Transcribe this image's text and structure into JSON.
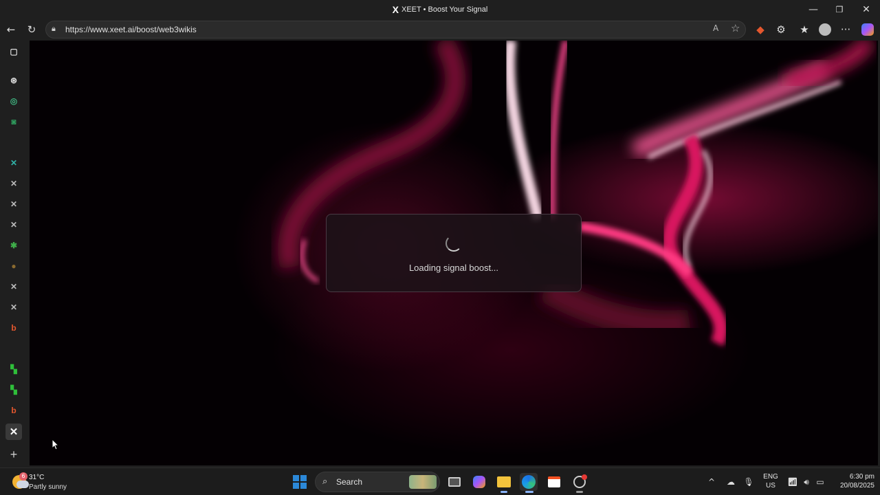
{
  "window": {
    "title": "XEET • Boost Your Signal",
    "logo_glyph": "X",
    "minimize_glyph": "—",
    "maximize_glyph": "❐",
    "close_glyph": "✕"
  },
  "toolbar": {
    "back_glyph": "←",
    "refresh_glyph": "↻",
    "url": "https://www.xeet.ai/boost/web3wikis",
    "read_aloud_glyph": "A",
    "favorite_glyph": "☆",
    "more_glyph": "···"
  },
  "sidebar": {
    "items": [
      {
        "name": "tab-actions-icon",
        "glyph": "▢",
        "color": "#dddddd"
      },
      {
        "name": "openai-icon",
        "glyph": "⊛",
        "color": "#dddddd"
      },
      {
        "name": "app-a-icon",
        "glyph": "◎",
        "color": "#3fb27f"
      },
      {
        "name": "app-green-icon",
        "glyph": "◙",
        "color": "#2f9e5e"
      },
      {
        "name": "x-teal-icon",
        "glyph": "✕",
        "color": "#31b3a8"
      },
      {
        "name": "x-tab-icon",
        "glyph": "✕",
        "color": "#bbbbbb"
      },
      {
        "name": "x-tab-icon",
        "glyph": "✕",
        "color": "#bbbbbb"
      },
      {
        "name": "x-tab-icon",
        "glyph": "✕",
        "color": "#bbbbbb"
      },
      {
        "name": "palm-icon",
        "glyph": "✱",
        "color": "#3fae4a"
      },
      {
        "name": "coin-icon",
        "glyph": "●",
        "color": "#8a6a2f"
      },
      {
        "name": "x-tab-icon",
        "glyph": "✕",
        "color": "#bbbbbb"
      },
      {
        "name": "x-tab-icon",
        "glyph": "✕",
        "color": "#bbbbbb"
      },
      {
        "name": "orange-app-icon",
        "glyph": "b",
        "color": "#e4572e"
      },
      {
        "name": "green-flag-icon",
        "glyph": "▚",
        "color": "#2fbf3a"
      },
      {
        "name": "green-flag-icon",
        "glyph": "▚",
        "color": "#2fbf3a"
      },
      {
        "name": "orange-app-icon",
        "glyph": "b",
        "color": "#e4572e"
      },
      {
        "name": "x-active-icon",
        "glyph": "✕",
        "color": "#ffffff"
      },
      {
        "name": "add-tab-icon",
        "glyph": "+",
        "color": "#cccccc"
      }
    ]
  },
  "loading": {
    "text": "Loading signal boost..."
  },
  "taskbar": {
    "weather_badge": "6",
    "temperature": "31°C",
    "weather_desc": "Partly sunny",
    "search_label": "Search",
    "language": "ENG",
    "region": "US",
    "time": "6:30 pm",
    "date": "20/08/2025",
    "tray_up_glyph": "^"
  },
  "colors": {
    "accent_pink": "#d2145a",
    "windows_blue": "#2b88d8"
  }
}
